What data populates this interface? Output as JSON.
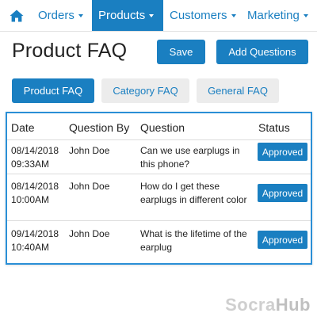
{
  "nav": {
    "home_icon": "home-icon",
    "items": [
      {
        "label": "Orders",
        "active": false
      },
      {
        "label": "Products",
        "active": true
      },
      {
        "label": "Customers",
        "active": false
      },
      {
        "label": "Marketing",
        "active": false
      }
    ]
  },
  "header": {
    "title": "Product FAQ",
    "save_label": "Save",
    "add_label": "Add Questions"
  },
  "tabs": [
    {
      "label": "Product FAQ",
      "active": true
    },
    {
      "label": "Category FAQ",
      "active": false
    },
    {
      "label": "General FAQ",
      "active": false
    }
  ],
  "table": {
    "columns": [
      "Date",
      "Question By",
      "Question",
      "Status"
    ],
    "rows": [
      {
        "date": "08/14/2018",
        "time": "09:33AM",
        "by": "John Doe",
        "question": "Can we use earplugs in this phone?",
        "status": "Approved"
      },
      {
        "date": "08/14/2018",
        "time": "10:00AM",
        "by": "John Doe",
        "question": "How do I get these earplugs in different color",
        "status": "Approved"
      },
      {
        "date": "09/14/2018",
        "time": "10:40AM",
        "by": "John Doe",
        "question": "What is the lifetime of the earplug",
        "status": "Approved"
      }
    ]
  },
  "brand": {
    "part1": "Socra",
    "part2": "Hub"
  },
  "colors": {
    "accent": "#1a7fc1",
    "panel_border": "#2a8fd6",
    "tab_inactive_bg": "#ececec"
  }
}
